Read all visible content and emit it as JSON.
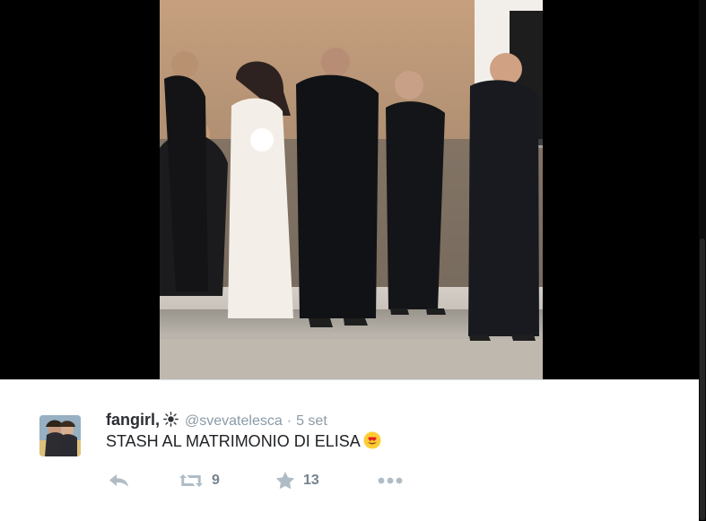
{
  "tweet": {
    "display_name": "fangirl,",
    "handle": "@svevatelesca",
    "separator": "·",
    "timestamp": "5 set",
    "text": "STASH AL MATRIMONIO DI ELISA"
  },
  "actions": {
    "retweets": "9",
    "favorites": "13"
  },
  "icons": {
    "name_decoration": "sun-icon",
    "text_decoration": "heart-eyes-emoji",
    "reply": "reply-icon",
    "retweet": "retweet-icon",
    "favorite": "star-icon",
    "more": "more-icon"
  },
  "colors": {
    "name": "#2b2f33",
    "meta": "#8a9aa7",
    "action": "#a7b3bd",
    "card_bg": "#ffffff",
    "viewer_bg": "#000000"
  }
}
